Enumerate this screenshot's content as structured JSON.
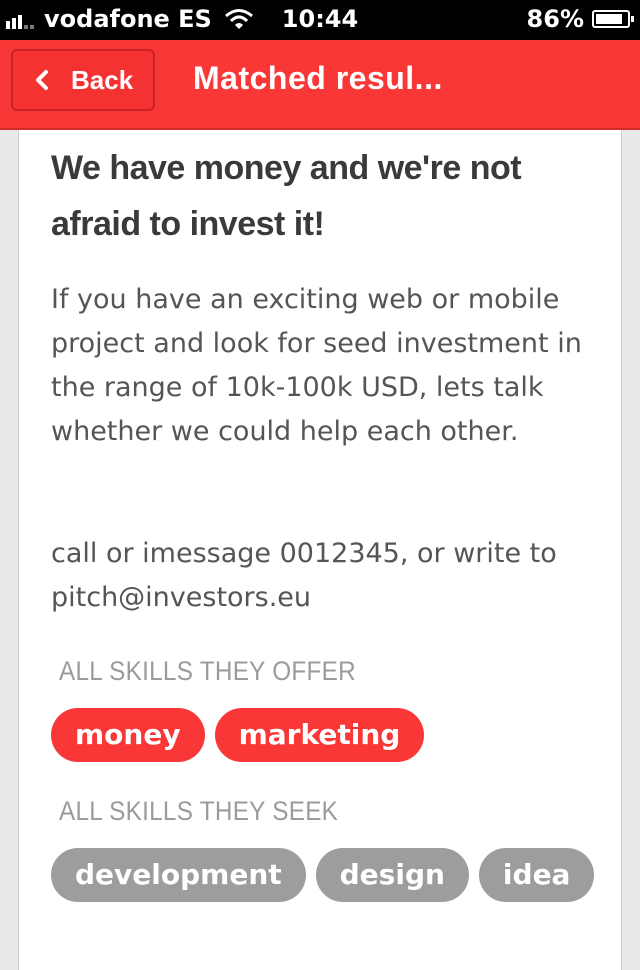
{
  "status_bar": {
    "carrier": "vodafone ES",
    "time": "10:44",
    "battery_percent": "86%",
    "signal_icon": "signal-bars-icon",
    "wifi_icon": "wifi-icon",
    "battery_icon": "battery-icon"
  },
  "nav": {
    "back_label": "Back",
    "back_icon": "chevron-left-icon",
    "title": "Matched resul..."
  },
  "post": {
    "heading": "We have money and we're not afraid to invest it!",
    "description": "If you have an exciting web or mobile project and look for seed investment in the range of 10k-100k USD, lets talk whether we could help each other.",
    "contact": "call or imessage 0012345, or write to pitch@investors.eu"
  },
  "offer": {
    "label": "ALL SKILLS THEY OFFER",
    "tags": [
      "money",
      "marketing"
    ]
  },
  "seek": {
    "label": "ALL SKILLS THEY SEEK",
    "tags": [
      "development",
      "design",
      "idea"
    ]
  },
  "colors": {
    "accent": "#f93737",
    "tag_seek": "#9d9d9d"
  }
}
